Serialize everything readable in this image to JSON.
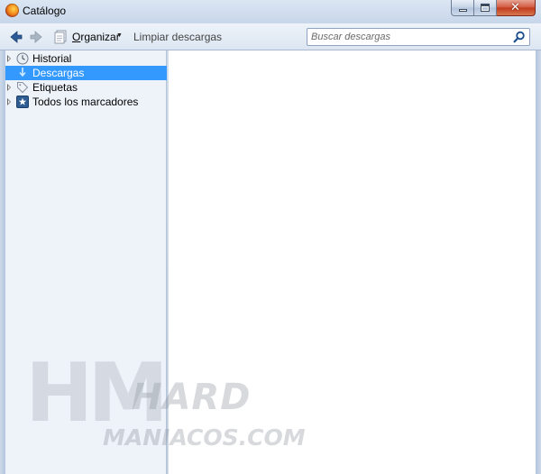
{
  "window": {
    "title": "Catálogo"
  },
  "toolbar": {
    "organize_label_underlined": "O",
    "organize_label_rest": "rganizar",
    "clear_downloads_label": "Limpiar descargas"
  },
  "search": {
    "placeholder": "Buscar descargas",
    "value": ""
  },
  "sidebar": {
    "items": [
      {
        "label": "Historial",
        "icon": "clock-icon",
        "expandable": true,
        "selected": false
      },
      {
        "label": "Descargas",
        "icon": "download-icon",
        "expandable": false,
        "selected": true
      },
      {
        "label": "Etiquetas",
        "icon": "tag-icon",
        "expandable": true,
        "selected": false
      },
      {
        "label": "Todos los marcadores",
        "icon": "star-icon",
        "expandable": true,
        "selected": false
      }
    ]
  },
  "watermark": {
    "line1": "HM",
    "line2": "HARD",
    "line3": "MANIACOS.COM"
  },
  "colors": {
    "selection": "#3399ff",
    "sidebar_bg": "#eef3fa",
    "chrome": "#c7d6ea",
    "close_button": "#c0391c"
  }
}
